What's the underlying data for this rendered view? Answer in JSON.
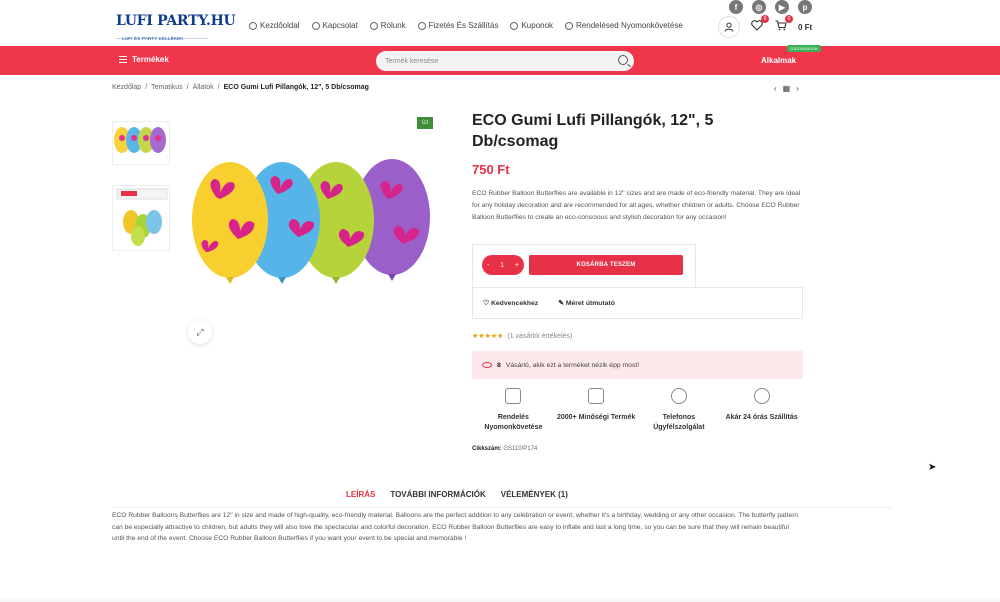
{
  "colors": {
    "accent": "#f0364b",
    "brand_blue": "#0e3d8c",
    "new_badge": "#3f8f3a"
  },
  "header": {
    "logo_text": "LUFI PARTY.HU",
    "logo_sub": "LUFI ÉS PARTY KELLÉKEK",
    "social": [
      {
        "icon": "facebook-icon",
        "glyph": "f"
      },
      {
        "icon": "instagram-icon",
        "glyph": "◎"
      },
      {
        "icon": "youtube-icon",
        "glyph": "▶"
      },
      {
        "icon": "pinterest-icon",
        "glyph": "p"
      }
    ],
    "nav": [
      {
        "label": "Kezdőoldal",
        "icon": "pin-icon"
      },
      {
        "label": "Kapcsolat",
        "icon": "handshake-icon"
      },
      {
        "label": "Rólunk",
        "icon": "info-icon"
      },
      {
        "label": "Fizetés És Szállítás",
        "icon": "truck-icon"
      },
      {
        "label": "Kuponok",
        "icon": "coupon-icon"
      },
      {
        "label": "Rendelésed Nyomonkövetése",
        "icon": "tracking-icon"
      }
    ],
    "wishlist_count": "0",
    "cart_count": "0",
    "cart_total": "0 Ft"
  },
  "menubar": {
    "products_label": "Termékek",
    "search_placeholder": "Termék keresése",
    "apps_label": "Alkalmak",
    "new_label": "ÚJDONSÁGOK"
  },
  "breadcrumb": [
    "Kezdőlap",
    "Tematikus",
    "Állatok"
  ],
  "breadcrumb_current": "ECO Gumi Lufi Pillangók, 12\", 5 Db/csomag",
  "product": {
    "badge": "ÚJ",
    "title": "ECO Gumi Lufi Pillangók, 12\", 5 Db/csomag",
    "price": "750 Ft",
    "description": "ECO Rubber Balloon Butterflies are available in 12\" sizes and are made of eco-friendly material. They are ideal for any holiday decoration and are recommended for all ages, whether children or adults. Choose ECO Rubber Balloon Butterflies to create an eco-conscious and stylish decoration for any occasion!",
    "qty": "1",
    "add_to_cart": "KOSÁRBA TESZEM",
    "wishlist": "Kedvencekhez",
    "size_guide": "Méret útmutató",
    "stars": "★★★★★",
    "rating_text": "(1 vásárlói értékelés)",
    "viewers_count": "8",
    "viewers_text": "Vásárló, akik ezt a terméket nézik épp most!",
    "features": [
      {
        "icon": "delivery-truck-icon",
        "label": "Rendelés Nyomonkövetése"
      },
      {
        "icon": "cake-icon",
        "label": "2000+ Minőségi Termék"
      },
      {
        "icon": "phone-icon",
        "label": "Telefonos Ügyfélszolgálat"
      },
      {
        "icon": "location-icon",
        "label": "Akár 24 órás Szállítás"
      }
    ],
    "sku_label": "Cikkszám:",
    "sku": "GS110/P174"
  },
  "tabs": [
    "LEÍRÁS",
    "TOVÁBBI INFORMÁCIÓK",
    "VÉLEMÉNYEK (1)"
  ],
  "long_description": "ECO Rubber Balloons Butterflies are 12\" in size and made of high-quality, eco-friendly material. Balloons are the perfect addition to any celebration or event, whether it's a birthday, wedding or any other occasion. The butterfly pattern can be especially attractive to children, but adults they will also love the spectacular and colorful decoration. ECO Rubber Balloon Butterflies are easy to inflate and last a long time, so you can be sure that they will remain beautiful until the end of the event. Choose ECO Rubber Balloon Butterflies if you want your event to be special and memorable !"
}
